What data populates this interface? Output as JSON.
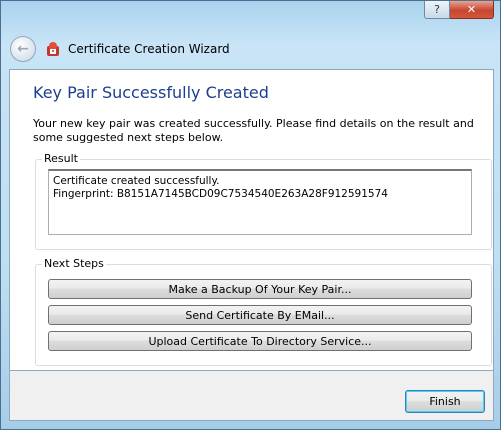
{
  "window": {
    "help_glyph": "?",
    "close_glyph": "✕",
    "title": "Certificate Creation Wizard",
    "back_glyph": "←"
  },
  "page": {
    "heading": "Key Pair Successfully Created",
    "description": "Your new key pair was created successfully. Please find details on the result and some suggested next steps below."
  },
  "result": {
    "legend": "Result",
    "line1": "Certificate created successfully.",
    "line2": "Fingerprint: B8151A7145BCD09C7534540E263A28F912591574"
  },
  "next_steps": {
    "legend": "Next Steps",
    "backup_label": "Make a Backup Of Your Key Pair...",
    "email_label": "Send Certificate By EMail...",
    "upload_label": "Upload Certificate To Directory Service..."
  },
  "footer": {
    "finish_label": "Finish"
  },
  "colors": {
    "heading": "#1b3f8f",
    "frame": "#bfdff3",
    "close_button": "#c7452f"
  },
  "icons": {
    "back": "back-arrow-icon",
    "app": "kleopatra-app-icon"
  }
}
